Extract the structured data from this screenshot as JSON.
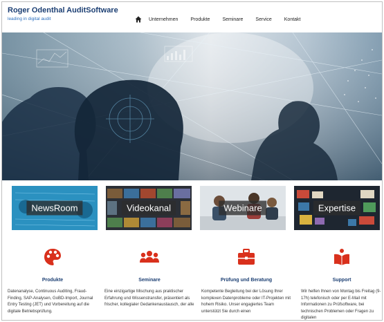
{
  "brand": {
    "title": "Roger Odenthal AuditSoftware",
    "tagline": "leading in digital audit"
  },
  "nav": {
    "home_icon": "home-icon",
    "items": [
      "Unternehmen",
      "Produkte",
      "Seminare",
      "Service",
      "Kontakt"
    ]
  },
  "tiles": [
    {
      "label": "NewsRoom"
    },
    {
      "label": "Videokanal"
    },
    {
      "label": "Webinare"
    },
    {
      "label": "Expertise"
    }
  ],
  "features": [
    {
      "icon": "palette-icon",
      "title": "Produkte",
      "text": "Datenanalyse, Continuous Auditing, Fraud-Finding, SAP-Analysen, GoBD-Import, Journal Entry Testing (JET) und Vorbereitung auf die digitale Betriebsprüfung."
    },
    {
      "icon": "users-icon",
      "title": "Seminare",
      "text": "Eine einzigartige Mischung aus praktischer Erfahrung und Wissenstransfer, präsentiert als frischer, kollegialer Gedankenaustausch, der alle"
    },
    {
      "icon": "briefcase-icon",
      "title": "Prüfung und Beratung",
      "text": "Kompetente Begleitung bei der Lösung Ihrer komplexen Datenprobleme oder IT-Projekten mit hohem Risiko. Unser engagiertes Team unterstützt Sie durch einen"
    },
    {
      "icon": "book-icon",
      "title": "Support",
      "text": "Wir helfen Ihnen von Montag bis Freitag (9-17h) telefonisch oder per E-Mail mit Informationen zu Prüfsoftware, bei technischen Problemen oder Fragen zu digitalen"
    }
  ],
  "colors": {
    "brand_blue": "#1c3f73",
    "accent_red": "#d9301c"
  }
}
